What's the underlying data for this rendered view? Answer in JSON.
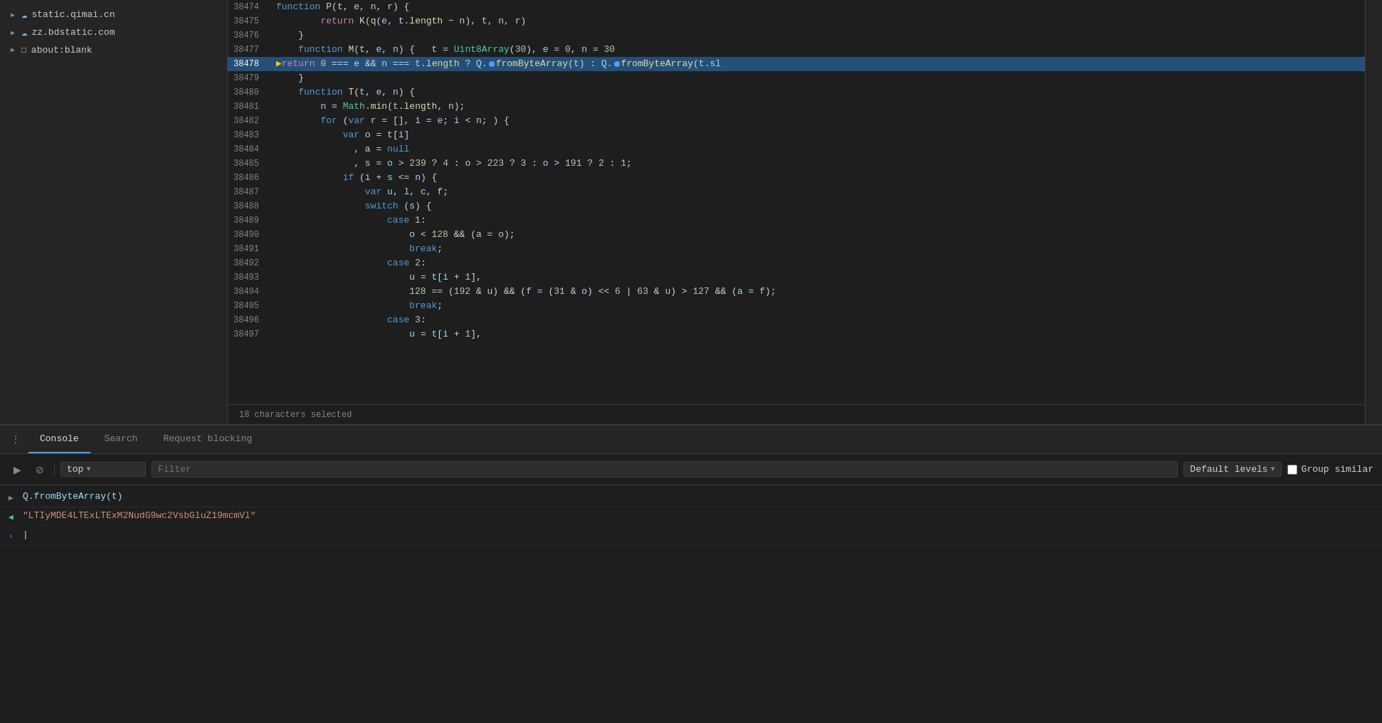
{
  "sidebar": {
    "items": [
      {
        "id": "static-qimai",
        "label": "static.qimai.cn",
        "type": "cloud",
        "arrow": "▶"
      },
      {
        "id": "zz-bdstatic",
        "label": "zz.bdstatic.com",
        "type": "cloud",
        "arrow": "▶"
      },
      {
        "id": "about-blank",
        "label": "about:blank",
        "type": "file",
        "arrow": "▶"
      }
    ]
  },
  "code": {
    "lines": [
      {
        "num": "38474",
        "content": "function P(t, e, n, r) {",
        "highlighted": false
      },
      {
        "num": "38475",
        "content": "        return K(q(e, t.length − n), t, n, r)",
        "highlighted": false
      },
      {
        "num": "38476",
        "content": "    }",
        "highlighted": false
      },
      {
        "num": "38477",
        "content": "    function M(t, e, n) {   t = Uint8Array(30), e = 0, n = 30",
        "highlighted": false
      },
      {
        "num": "38478",
        "content": "        return 0 === e && n === t.length ? Q.fromByteArray(t) : Q.fromByteArray(t.sl",
        "highlighted": true
      },
      {
        "num": "38479",
        "content": "    }",
        "highlighted": false
      },
      {
        "num": "38480",
        "content": "    function T(t, e, n) {",
        "highlighted": false
      },
      {
        "num": "38481",
        "content": "        n = Math.min(t.length, n);",
        "highlighted": false
      },
      {
        "num": "38482",
        "content": "        for (var r = [], i = e; i < n; ) {",
        "highlighted": false
      },
      {
        "num": "38483",
        "content": "            var o = t[i]",
        "highlighted": false
      },
      {
        "num": "38484",
        "content": "              , a = null",
        "highlighted": false
      },
      {
        "num": "38485",
        "content": "              , s = o > 239 ? 4 : o > 223 ? 3 : o > 191 ? 2 : 1;",
        "highlighted": false
      },
      {
        "num": "38486",
        "content": "            if (i + s <= n) {",
        "highlighted": false
      },
      {
        "num": "38487",
        "content": "                var u, l, c, f;",
        "highlighted": false
      },
      {
        "num": "38488",
        "content": "                switch (s) {",
        "highlighted": false
      },
      {
        "num": "38489",
        "content": "                    case 1:",
        "highlighted": false
      },
      {
        "num": "38490",
        "content": "                        o < 128 && (a = o);",
        "highlighted": false
      },
      {
        "num": "38491",
        "content": "                        break;",
        "highlighted": false
      },
      {
        "num": "38492",
        "content": "                    case 2:",
        "highlighted": false
      },
      {
        "num": "38493",
        "content": "                        u = t[i + 1],",
        "highlighted": false
      },
      {
        "num": "38494",
        "content": "                        128 == (192 & u) && (f = (31 & o) << 6 | 63 & u) > 127 && (a = f);",
        "highlighted": false
      },
      {
        "num": "38495",
        "content": "                        break;",
        "highlighted": false
      },
      {
        "num": "38496",
        "content": "                    case 3:",
        "highlighted": false
      },
      {
        "num": "38497",
        "content": "                        u = t[i + 1],",
        "highlighted": false
      }
    ],
    "status": "18 characters selected"
  },
  "devtools": {
    "tabs": [
      {
        "id": "console",
        "label": "Console",
        "active": true
      },
      {
        "id": "search",
        "label": "Search",
        "active": false
      },
      {
        "id": "request-blocking",
        "label": "Request blocking",
        "active": false
      }
    ],
    "toolbar": {
      "clear_label": "⊘",
      "execute_label": "▶",
      "context": "top",
      "filter_placeholder": "Filter",
      "levels_label": "Default levels",
      "group_similar_label": "Group similar"
    },
    "output": [
      {
        "type": "expandable",
        "icon": "▶",
        "content": "Q.fromByteArray(t)",
        "color": "result"
      },
      {
        "type": "return",
        "icon": "◀",
        "content": "\"LTIyMDE4LTExLTExM2NudG9wc2VsbGluZ19mcmVl\"",
        "color": "string"
      },
      {
        "type": "prompt",
        "icon": "",
        "content": "",
        "color": "prompt"
      }
    ]
  }
}
